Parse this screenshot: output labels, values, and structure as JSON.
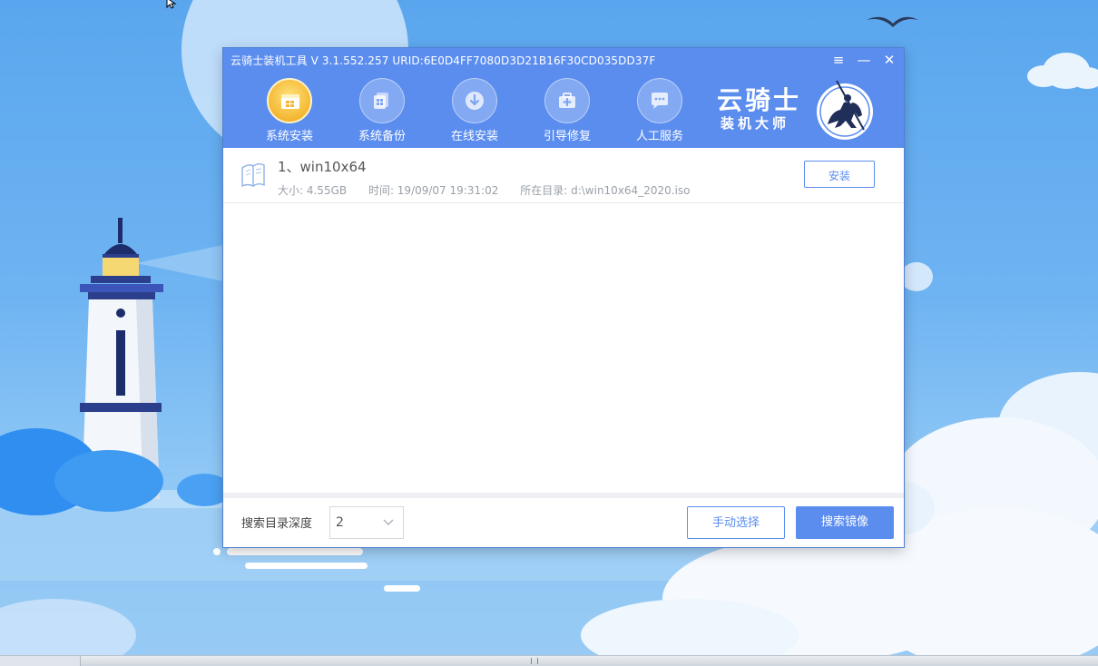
{
  "window": {
    "title": "云骑士装机工具 V 3.1.552.257 URID:6E0D4FF7080D3D21B16F30CD035DD37F",
    "controls": [
      "≡",
      "—",
      "✕"
    ]
  },
  "nav": {
    "items": [
      {
        "label": "系统安装",
        "icon": "system-install-icon",
        "active": true
      },
      {
        "label": "系统备份",
        "icon": "system-backup-icon",
        "active": false
      },
      {
        "label": "在线安装",
        "icon": "online-install-icon",
        "active": false
      },
      {
        "label": "引导修复",
        "icon": "boot-repair-icon",
        "active": false
      },
      {
        "label": "人工服务",
        "icon": "chat-service-icon",
        "active": false
      }
    ]
  },
  "brand": {
    "line1": "云骑士",
    "line2": "装机大师"
  },
  "list": {
    "items": [
      {
        "name": "1、win10x64",
        "size": "大小: 4.55GB",
        "time": "时间: 19/09/07 19:31:02",
        "dir": "所在目录: d:\\win10x64_2020.iso",
        "action": "安装"
      }
    ]
  },
  "footer": {
    "depth_label": "搜索目录深度",
    "depth_value": "2",
    "manual_label": "手动选择",
    "search_label": "搜索镜像"
  },
  "colors": {
    "accent": "#5b8def",
    "header": "#5b8def",
    "active_nav": "#f4b733"
  }
}
